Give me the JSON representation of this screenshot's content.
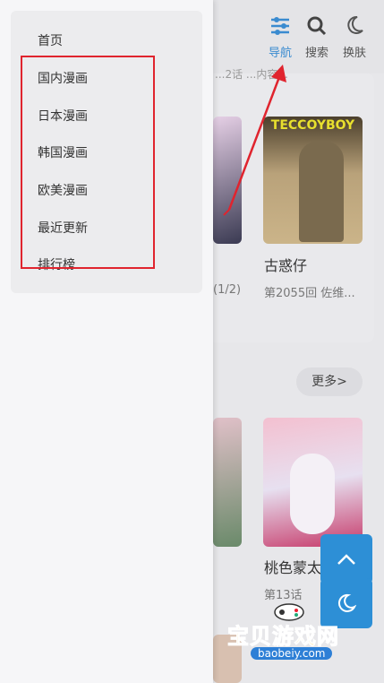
{
  "header": {
    "nav": {
      "label": "导航"
    },
    "search": {
      "label": "搜索"
    },
    "theme": {
      "label": "换肤"
    }
  },
  "drawer": {
    "items": [
      {
        "label": "首页"
      },
      {
        "label": "国内漫画"
      },
      {
        "label": "日本漫画"
      },
      {
        "label": "韩国漫画"
      },
      {
        "label": "欧美漫画"
      },
      {
        "label": "最近更新"
      },
      {
        "label": "排行榜"
      }
    ]
  },
  "section1": {
    "partial_caption": "(1/2)",
    "top_partial_text": "...2话  ...内容...",
    "card": {
      "title": "古惑仔",
      "subtitle": "第2055回 佐维...",
      "cover_text": "TECCOYBOY"
    }
  },
  "section2": {
    "more_label": "更多>",
    "card": {
      "title": "桃色蒙太奇",
      "subtitle": "第13话"
    }
  },
  "watermark": {
    "cn": "宝贝游戏网",
    "url": "baobeiy.com"
  },
  "colors": {
    "accent": "#2d8fd6",
    "annotation_red": "#e0242e"
  }
}
